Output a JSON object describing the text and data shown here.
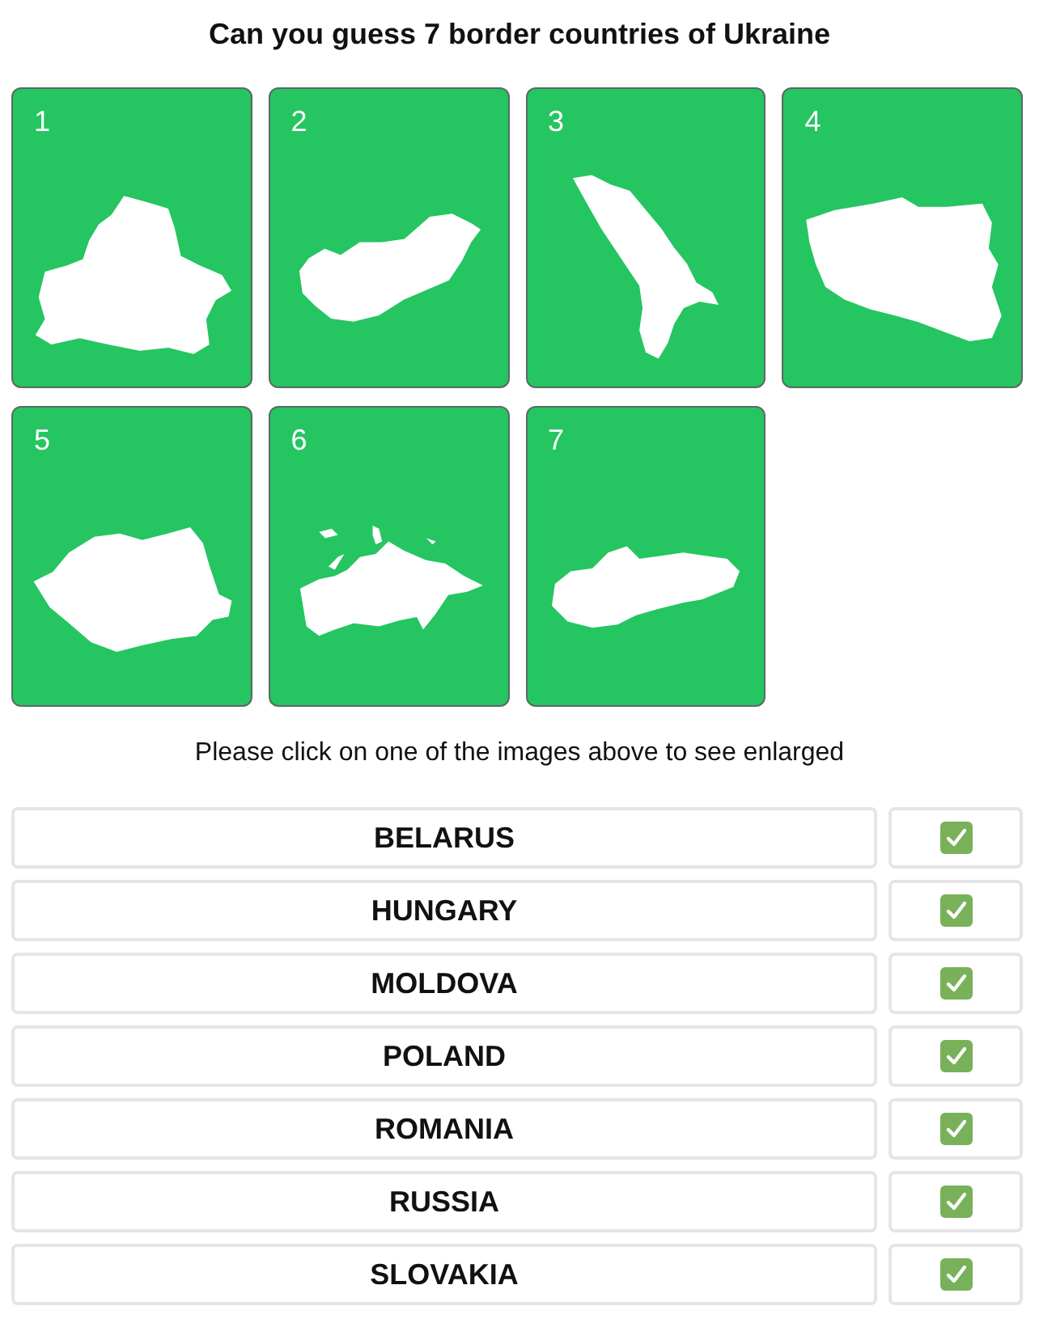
{
  "title": "Can you guess 7 border countries of Ukraine",
  "cards": [
    {
      "label": "1"
    },
    {
      "label": "2"
    },
    {
      "label": "3"
    },
    {
      "label": "4"
    },
    {
      "label": "5"
    },
    {
      "label": "6"
    },
    {
      "label": "7"
    }
  ],
  "hint": "Please click on one of the images above to see enlarged",
  "answers": [
    {
      "name": "BELARUS",
      "checked": true
    },
    {
      "name": "HUNGARY",
      "checked": true
    },
    {
      "name": "MOLDOVA",
      "checked": true
    },
    {
      "name": "POLAND",
      "checked": true
    },
    {
      "name": "ROMANIA",
      "checked": true
    },
    {
      "name": "RUSSIA",
      "checked": true
    },
    {
      "name": "SLOVAKIA",
      "checked": true
    }
  ]
}
